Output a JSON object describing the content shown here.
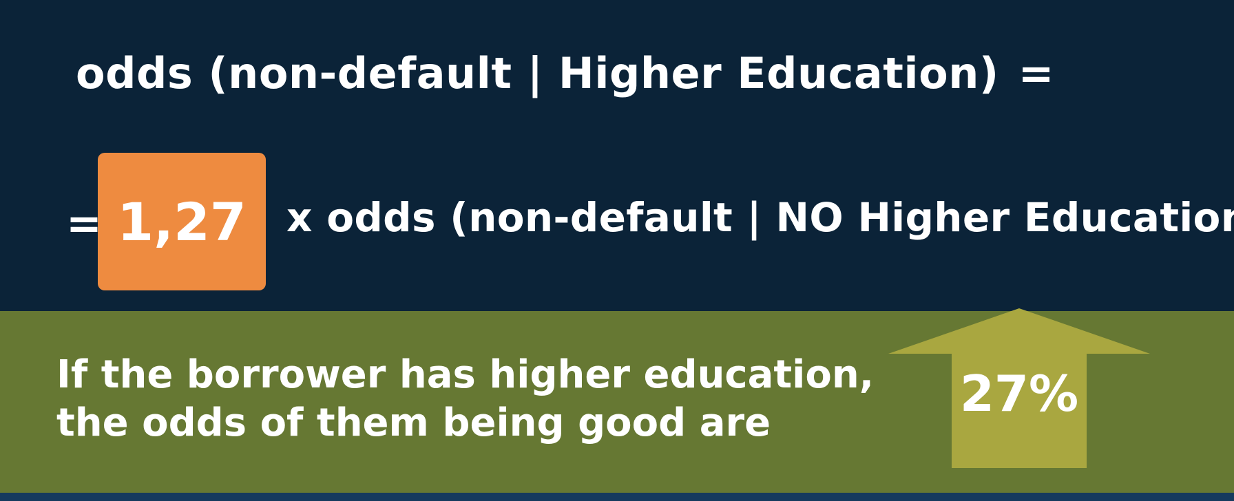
{
  "equation": {
    "line1_text": "odds (non-default | Higher Education)",
    "line1_equals": "=",
    "line2_equals": "=",
    "coefficient": "1,27",
    "line2_text": "x odds (non-default  | NO Higher Education)"
  },
  "interpretation": {
    "line1": "If the borrower has higher education,",
    "line2": "the odds of them being good are",
    "change_value": "27%",
    "arrow_icon": "arrow-up-icon"
  },
  "colors": {
    "background": "#0b2338",
    "accent_orange": "#ee8b40",
    "panel_green": "#667833",
    "arrow_olive": "#a9a740"
  }
}
